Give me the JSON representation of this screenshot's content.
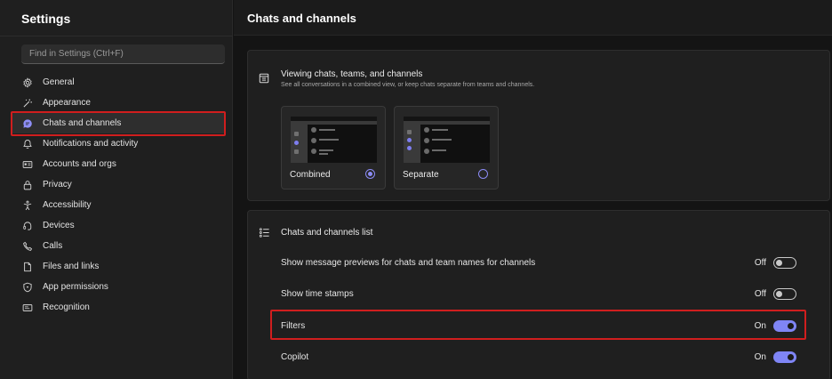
{
  "sidebar": {
    "title": "Settings",
    "search_placeholder": "Find in Settings (Ctrl+F)",
    "items": [
      {
        "label": "General",
        "icon": "gear-icon"
      },
      {
        "label": "Appearance",
        "icon": "wand-icon"
      },
      {
        "label": "Chats and channels",
        "icon": "chat-bubble-icon",
        "active": true
      },
      {
        "label": "Notifications and activity",
        "icon": "bell-icon"
      },
      {
        "label": "Accounts and orgs",
        "icon": "id-card-icon"
      },
      {
        "label": "Privacy",
        "icon": "lock-icon"
      },
      {
        "label": "Accessibility",
        "icon": "accessibility-icon"
      },
      {
        "label": "Devices",
        "icon": "headset-icon"
      },
      {
        "label": "Calls",
        "icon": "phone-icon"
      },
      {
        "label": "Files and links",
        "icon": "document-icon"
      },
      {
        "label": "App permissions",
        "icon": "shield-icon"
      },
      {
        "label": "Recognition",
        "icon": "recognition-icon"
      }
    ]
  },
  "main": {
    "title": "Chats and channels",
    "viewing": {
      "title": "Viewing chats, teams, and channels",
      "subtitle": "See all conversations in a combined view, or keep chats separate from teams and channels.",
      "options": [
        {
          "label": "Combined",
          "selected": true
        },
        {
          "label": "Separate",
          "selected": false
        }
      ]
    },
    "list_section": {
      "title": "Chats and channels list",
      "settings": [
        {
          "label": "Show message previews for chats and team names for channels",
          "state": "Off",
          "on": false
        },
        {
          "label": "Show time stamps",
          "state": "Off",
          "on": false
        },
        {
          "label": "Filters",
          "state": "On",
          "on": true
        },
        {
          "label": "Copilot",
          "state": "On",
          "on": true
        }
      ]
    }
  },
  "colors": {
    "accent": "#7f85f5",
    "highlight_box": "#d01e1e",
    "background": "#141414",
    "panel": "#1f1f1f"
  }
}
